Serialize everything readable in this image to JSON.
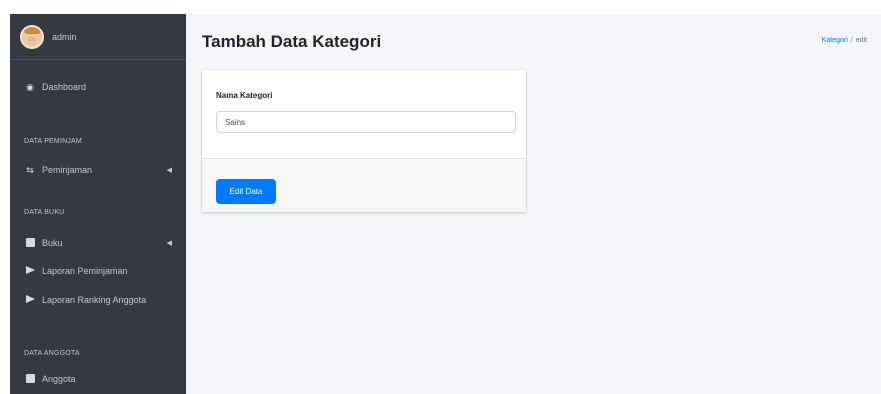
{
  "sidebar": {
    "username": "admin",
    "items": [
      {
        "label": "Dashboard",
        "icon": "dashboard-icon"
      },
      {
        "label": "Peminjaman",
        "icon": "exchange-icon"
      },
      {
        "label": "Buku",
        "icon": "book-icon"
      },
      {
        "label": "Laporan Peminjaman",
        "icon": "flag-icon"
      },
      {
        "label": "Laporan Ranking Anggota",
        "icon": "flag-icon"
      },
      {
        "label": "Anggota",
        "icon": "members-icon"
      }
    ],
    "headers": [
      "DATA PEMINJAM",
      "DATA BUKU",
      "DATA ANGGOTA"
    ]
  },
  "header": {
    "title": "Tambah Data Kategori",
    "breadcrumb": {
      "link": "Kategori",
      "separator": "/",
      "active": "edit"
    }
  },
  "form": {
    "field_label": "Nama Kategori",
    "field_value": "Sains",
    "submit_label": "Edit Data"
  },
  "colors": {
    "sidebar_bg": "#343a40",
    "content_bg": "#f4f6f9",
    "primary": "#007bff"
  }
}
